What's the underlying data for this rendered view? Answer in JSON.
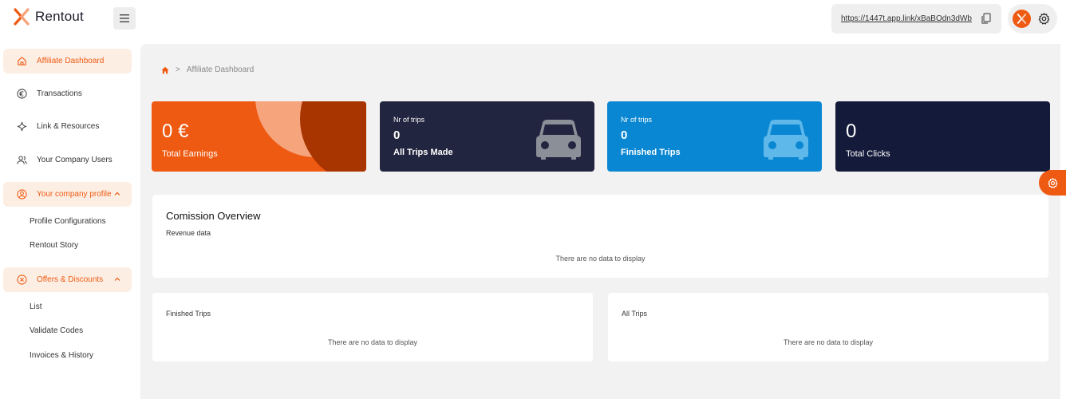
{
  "brand": {
    "name": "Rentout",
    "accent": "#ee5a12"
  },
  "topbar": {
    "affiliate_link": "https://1447t.app.link/xBaBOdn3dWb",
    "icons": [
      "menu-icon",
      "copy-icon",
      "rentout-logo-icon",
      "gear-icon"
    ]
  },
  "sidebar": {
    "items": [
      {
        "label": "Affiliate Dashboard",
        "icon": "home-icon",
        "active": true
      },
      {
        "label": "Transactions",
        "icon": "euro-icon"
      },
      {
        "label": "Link & Resources",
        "icon": "sparkle-icon"
      },
      {
        "label": "Your Company Users",
        "icon": "users-icon"
      },
      {
        "label": "Your company profile",
        "icon": "user-circle-icon",
        "expanded": true
      },
      {
        "label": "Offers & Discounts",
        "icon": "x-circle-icon",
        "expanded": true
      }
    ],
    "profile_sub": [
      "Profile Configurations",
      "Rentout Story"
    ],
    "offers_sub": [
      "List",
      "Validate Codes",
      "Invoices & History"
    ]
  },
  "breadcrumb": {
    "current": "Affiliate Dashboard"
  },
  "cards": {
    "earnings": {
      "value": "0 €",
      "label": "Total Earnings",
      "color": "#ee5a12"
    },
    "all_trips": {
      "caption": "Nr of trips",
      "value": "0",
      "label": "All Trips Made",
      "color": "#22253f"
    },
    "finished_trips": {
      "caption": "Nr of trips",
      "value": "0",
      "label": "Finished Trips",
      "color": "#0a87d2"
    },
    "clicks": {
      "value": "0",
      "label": "Total Clicks",
      "color": "#141a3a"
    }
  },
  "commission": {
    "title": "Comission Overview",
    "subtitle": "Revenue data",
    "empty": "There are no data to display"
  },
  "finished_panel": {
    "title": "Finished Trips",
    "empty": "There are no data to display"
  },
  "all_panel": {
    "title": "All Trips",
    "empty": "There are no data to display"
  }
}
